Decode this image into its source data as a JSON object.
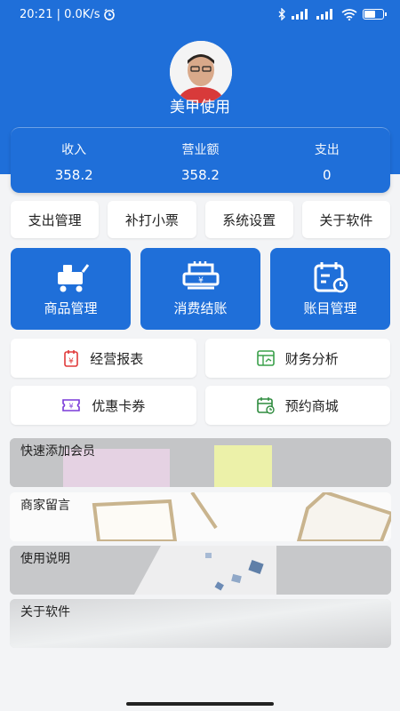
{
  "status_bar": {
    "time_speed": "20:21 | 0.0K/s",
    "alarm_icon": "alarm-clock-icon",
    "bluetooth_icon": "bluetooth-icon",
    "signal1": "signal-icon",
    "signal2": "signal-icon",
    "wifi_icon": "wifi-icon",
    "battery_icon": "battery-icon"
  },
  "profile": {
    "username": "美甲使用"
  },
  "stats": [
    {
      "label": "收入",
      "value": "358.2"
    },
    {
      "label": "营业额",
      "value": "358.2"
    },
    {
      "label": "支出",
      "value": "0"
    }
  ],
  "actions": [
    {
      "label": "支出管理"
    },
    {
      "label": "补打小票"
    },
    {
      "label": "系统设置"
    },
    {
      "label": "关于软件"
    }
  ],
  "big_buttons": [
    {
      "label": "商品管理",
      "icon": "cart-icon"
    },
    {
      "label": "消费结账",
      "icon": "checkout-icon"
    },
    {
      "label": "账目管理",
      "icon": "calendar-icon"
    }
  ],
  "grid": [
    {
      "label": "经营报表",
      "icon": "report-icon",
      "color": "#e03a3a"
    },
    {
      "label": "财务分析",
      "icon": "analysis-icon",
      "color": "#3aa04a"
    },
    {
      "label": "优惠卡券",
      "icon": "coupon-icon",
      "color": "#7a3ad9"
    },
    {
      "label": "预约商城",
      "icon": "booking-icon",
      "color": "#2e8b3e"
    }
  ],
  "banners": [
    {
      "title": "快速添加会员"
    },
    {
      "title": "商家留言"
    },
    {
      "title": "使用说明"
    },
    {
      "title": "关于软件"
    }
  ],
  "colors": {
    "primary": "#1f6fd9",
    "background": "#f3f4f6"
  }
}
